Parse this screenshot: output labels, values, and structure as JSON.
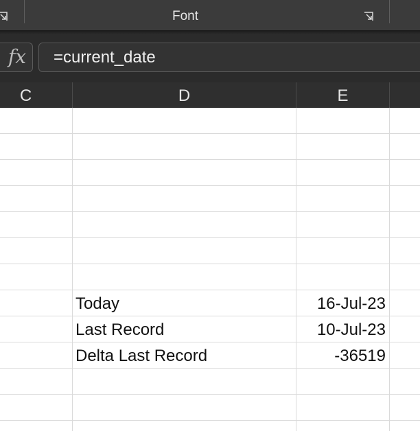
{
  "ribbon": {
    "group_label": "Font",
    "icons": [
      "dialog-launcher-icon",
      "dialog-launcher-icon"
    ]
  },
  "formula_bar": {
    "fx_label": "fx",
    "value": "=current_date"
  },
  "columns": [
    "C",
    "D",
    "E"
  ],
  "rows": [
    {
      "label": "Today",
      "value": "16-Jul-23"
    },
    {
      "label": "Last Record",
      "value": "10-Jul-23"
    },
    {
      "label": "Delta Last Record",
      "value": "-36519"
    }
  ],
  "colors": {
    "ribbon_bg": "#3b3b3b",
    "header_bg": "#2f2f2f",
    "gridline": "#dadada"
  }
}
